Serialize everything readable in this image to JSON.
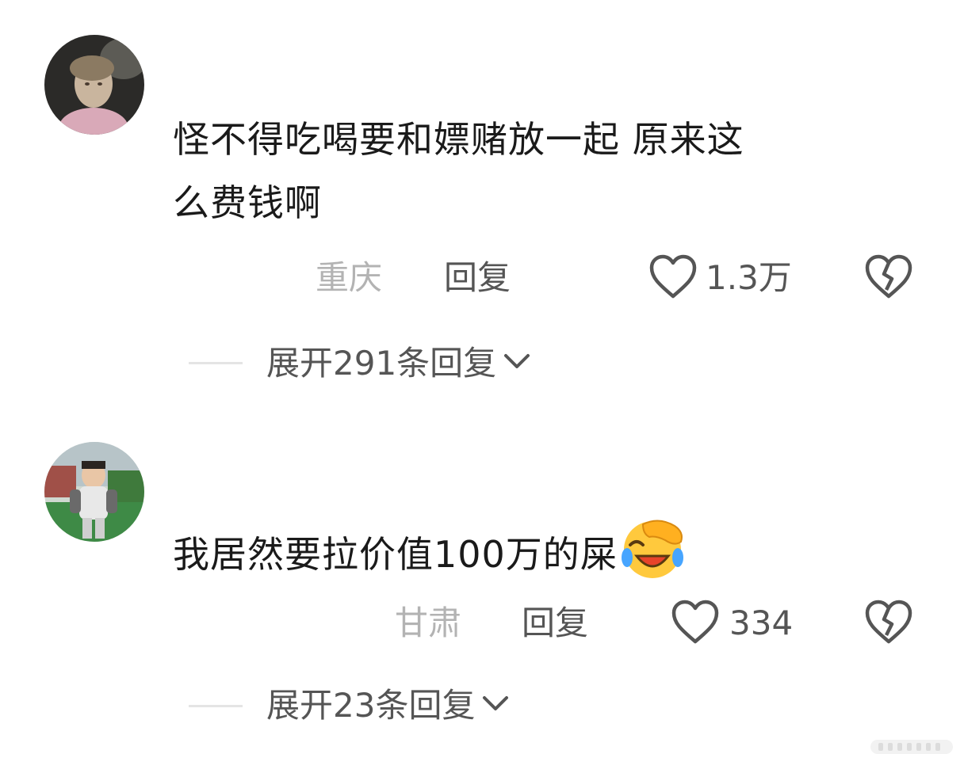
{
  "comments": [
    {
      "text_line1": "怪不得吃喝要和嫖赌放一起 原来这",
      "text_line2": "么费钱啊",
      "location": "重庆",
      "reply_label": "回复",
      "likes": "1.3万",
      "expand_label": "展开291条回复",
      "avatar_icon": "avatar-child-blurry",
      "like_icon": "heart-outline-icon",
      "dislike_icon": "broken-heart-icon"
    },
    {
      "text": "我居然要拉价值100万的屎",
      "emoji": "face-palm-laughing-emoji",
      "location": "甘肃",
      "reply_label": "回复",
      "likes": "334",
      "expand_label": "展开23条回复",
      "avatar_icon": "avatar-toddler-outdoor",
      "like_icon": "heart-outline-icon",
      "dislike_icon": "broken-heart-icon"
    }
  ],
  "colors": {
    "text": "#1a1a1a",
    "location": "#b3b3b3",
    "secondary": "#555555",
    "divider": "#e4e4e4"
  }
}
